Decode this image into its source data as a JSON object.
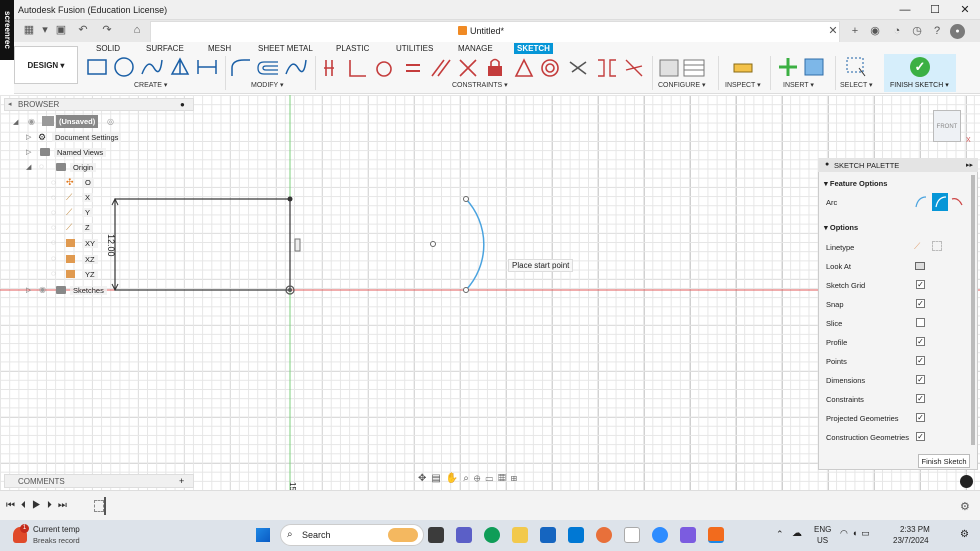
{
  "window": {
    "title": "Autodesk Fusion (Education License)",
    "min": "—",
    "max": "☐",
    "close": "✕",
    "recorder": "screenrec"
  },
  "document": {
    "title": "Untitled*"
  },
  "workspace": {
    "label": "DESIGN ▾"
  },
  "tabs": [
    "SOLID",
    "SURFACE",
    "MESH",
    "SHEET METAL",
    "PLASTIC",
    "UTILITIES",
    "MANAGE",
    "SKETCH"
  ],
  "groups": {
    "create": "CREATE ▾",
    "modify": "MODIFY ▾",
    "constraints": "CONSTRAINTS ▾",
    "configure": "CONFIGURE ▾",
    "inspect": "INSPECT ▾",
    "insert": "INSERT ▾",
    "select": "SELECT ▾",
    "finish": "FINISH SKETCH ▾"
  },
  "browser": {
    "title": "BROWSER",
    "root": "(Unsaved)",
    "items": [
      "Document Settings",
      "Named Views",
      "Origin",
      "O",
      "X",
      "Y",
      "Z",
      "XY",
      "XZ",
      "YZ",
      "Sketches"
    ]
  },
  "comments": "COMMENTS",
  "canvas": {
    "dimension": "12.00",
    "tooltip": "Place start point",
    "axis_label": "15",
    "viewcube": "FRONT",
    "viewcube_axis": "X"
  },
  "palette": {
    "title": "SKETCH PALETTE",
    "feature_options": "Feature Options",
    "arc_label": "Arc",
    "options": "Options",
    "linetype": "Linetype",
    "lookat": "Look At",
    "checks": [
      {
        "label": "Sketch Grid",
        "checked": true
      },
      {
        "label": "Snap",
        "checked": true
      },
      {
        "label": "Slice",
        "checked": false
      },
      {
        "label": "Profile",
        "checked": true
      },
      {
        "label": "Points",
        "checked": true
      },
      {
        "label": "Dimensions",
        "checked": true
      },
      {
        "label": "Constraints",
        "checked": true
      },
      {
        "label": "Projected Geometries",
        "checked": true
      },
      {
        "label": "Construction Geometries",
        "checked": true
      }
    ],
    "finish_button": "Finish Sketch"
  },
  "taskbar": {
    "weather_title": "Current temp",
    "weather_sub": "Breaks record",
    "weather_badge": "1",
    "search": "Search",
    "lang1": "ENG",
    "lang2": "US",
    "time": "2:33 PM",
    "date": "23/7/2024"
  },
  "colors": {
    "accent": "#0696d7",
    "finish_green": "#3cb043",
    "arc_blue": "#4aa3df",
    "x_axis": "#e05a5a",
    "y_axis": "#7ccf7c"
  }
}
